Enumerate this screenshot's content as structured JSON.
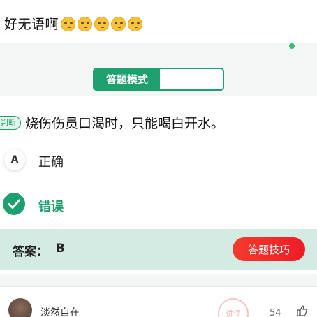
{
  "post": {
    "text": "好无语啊",
    "emoji_count": 5,
    "emoji_icon": "smirk-face-emoji"
  },
  "mode": {
    "active_label": "答题模式",
    "inactive_label": ""
  },
  "question": {
    "type_badge": "判断",
    "text": "烧伤伤员口渴时，只能喝白开水。",
    "options": [
      {
        "letter": "A",
        "text": "正确"
      },
      {
        "letter": "",
        "text": "错误",
        "selected": true,
        "icon": "check-icon"
      }
    ]
  },
  "answer": {
    "label": "答案：",
    "value": "B",
    "tips_label": "答题技巧"
  },
  "comment": {
    "user": "淡然自在",
    "count": "54",
    "like_icon": "thumbs-up-icon"
  },
  "colors": {
    "accent": "#1e9f6e",
    "answer_bar": "#d4ebe3",
    "tips_button": "#ee1c25"
  }
}
